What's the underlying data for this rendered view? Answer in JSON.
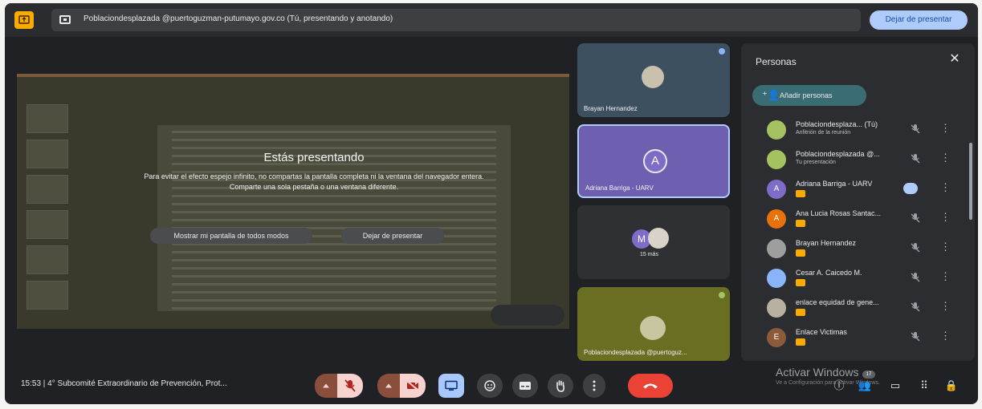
{
  "topbar": {
    "share_text": "Poblaciondesplazada @puertoguzman-putumayo.gov.co (Tú, presentando y anotando)",
    "stop_label": "Dejar de presentar"
  },
  "presentation": {
    "title": "Estás presentando",
    "message": "Para evitar el efecto espejo infinito, no compartas la pantalla completa ni la ventana del navegador entera. Comparte una sola pestaña o una ventana diferente.",
    "show_button": "Mostrar mi pantalla de todos modos",
    "stop_button": "Dejar de presentar"
  },
  "tiles": [
    {
      "name": "Brayan Hernandez"
    },
    {
      "name": "Adriana Barriga - UARV",
      "initial": "A"
    },
    {
      "name": "",
      "initial": "M",
      "more": "15 más"
    },
    {
      "name": "Poblaciondesplazada @puertoguz..."
    }
  ],
  "people": {
    "title": "Personas",
    "add_label": "Añadir personas",
    "rows": [
      {
        "name": "Poblaciondesplaza...  (Tú)",
        "sub": "Anfitrión de la reunión",
        "color": "#a5c261",
        "initial": ""
      },
      {
        "name": "Poblaciondesplazada @...",
        "sub": "Tu presentación",
        "color": "#a5c261",
        "initial": ""
      },
      {
        "name": "Adriana Barriga - UARV",
        "sub": "",
        "color": "#7e6cc8",
        "initial": "A"
      },
      {
        "name": "Ana Lucia Rosas Santac...",
        "sub": "",
        "color": "#e8710a",
        "initial": "A"
      },
      {
        "name": "Brayan Hernandez",
        "sub": "",
        "color": "#9e9e9e",
        "initial": ""
      },
      {
        "name": "Cesar A. Caicedo M.",
        "sub": "",
        "color": "#8ab4f8",
        "initial": ""
      },
      {
        "name": "enlace equidad de gene...",
        "sub": "",
        "color": "#b8b0a0",
        "initial": ""
      },
      {
        "name": "Enlace Victimas",
        "sub": "",
        "color": "#8d5a3b",
        "initial": "E"
      }
    ]
  },
  "bottombar": {
    "meeting_info": "15:53  |  4° Subcomité Extraordinario de Prevención, Prot...",
    "watermark": "Activar Windows",
    "watermark_sub": "Ve a Configuración para activar Windows.",
    "people_count": "17"
  }
}
